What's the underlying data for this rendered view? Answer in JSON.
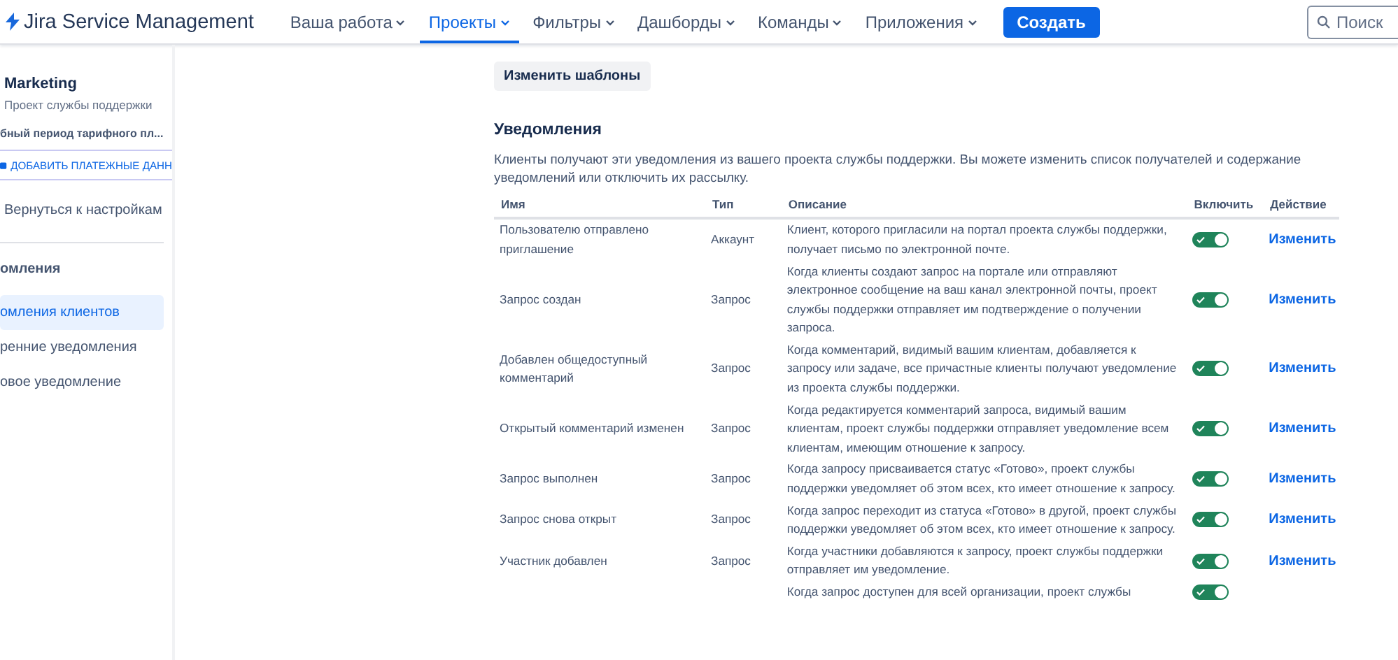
{
  "header": {
    "product": "Jira Service Management",
    "nav": [
      {
        "label": "Ваша работа",
        "selected": false
      },
      {
        "label": "Проекты",
        "selected": true
      },
      {
        "label": "Фильтры",
        "selected": false
      },
      {
        "label": "Дашборды",
        "selected": false
      },
      {
        "label": "Команды",
        "selected": false
      },
      {
        "label": "Приложения",
        "selected": false
      }
    ],
    "create_button": "Создать",
    "search": {
      "placeholder": "Поиск"
    }
  },
  "sidebar": {
    "project_name": "Marketing",
    "project_type": "Проект службы поддержки",
    "trial": "бный период тарифного пл...",
    "billing_button": "ДОБАВИТЬ ПЛАТЕЖНЫЕ ДАНН",
    "back_link": "Вернуться к настройкам",
    "section_title": "омления",
    "items": [
      {
        "label": "омления клиентов",
        "selected": true
      },
      {
        "label": "ренние уведомления",
        "selected": false
      },
      {
        "label": "овое уведомление",
        "selected": false
      }
    ]
  },
  "main": {
    "templates_button": "Изменить шаблоны",
    "section_title": "Уведомления",
    "section_text": "Клиенты получают эти уведомления из вашего проекта службы поддержки. Вы можете изменить список получателей и содержание уведомлений или отключить их рассылку.",
    "table": {
      "columns": [
        "Имя",
        "Тип",
        "Описание",
        "Включить",
        "Действие"
      ],
      "rows": [
        {
          "name": "Пользователю отправлено приглашение",
          "type": "Аккаунт",
          "description": "Клиент, которого пригласили на портал проекта службы поддержки, получает письмо по электронной почте.",
          "on": true,
          "action": "Изменить"
        },
        {
          "name": "Запрос создан",
          "type": "Запрос",
          "description": "Когда клиенты создают запрос на портале или отправляют электронное сообщение на ваш канал электронной почты, проект службы поддержки отправляет им подтверждение о получении запроса.",
          "on": true,
          "action": "Изменить"
        },
        {
          "name": "Добавлен общедоступный комментарий",
          "type": "Запрос",
          "description": "Когда комментарий, видимый вашим клиентам, добавляется к запросу или задаче, все причастные клиенты получают уведомление из проекта службы поддержки.",
          "on": true,
          "action": "Изменить"
        },
        {
          "name": "Открытый комментарий изменен",
          "type": "Запрос",
          "description": "Когда редактируется комментарий запроса, видимый вашим клиентам, проект службы поддержки отправляет уведомление всем клиентам, имеющим отношение к запросу.",
          "on": true,
          "action": "Изменить"
        },
        {
          "name": "Запрос выполнен",
          "type": "Запрос",
          "description": "Когда запросу присваивается статус «Готово», проект службы поддержки уведомляет об этом всех, кто имеет отношение к запросу.",
          "on": true,
          "action": "Изменить"
        },
        {
          "name": "Запрос снова открыт",
          "type": "Запрос",
          "description": "Когда запрос переходит из статуса «Готово» в другой, проект службы поддержки уведомляет об этом всех, кто имеет отношение к запросу.",
          "on": true,
          "action": "Изменить"
        },
        {
          "name": "Участник добавлен",
          "type": "Запрос",
          "description": "Когда участники добавляются к запросу, проект службы поддержки отправляет им уведомление.",
          "on": true,
          "action": "Изменить"
        },
        {
          "description": "Когда запрос доступен для всей организации, проект службы",
          "on": true
        }
      ]
    }
  }
}
